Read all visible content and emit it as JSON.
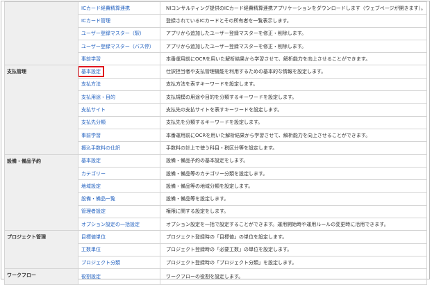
{
  "groups": [
    {
      "category": "",
      "rows": [
        {
          "link": "ICカード経費精算連携",
          "desc": "NIコンサルティング提供のICカード経費精算連携アプリケーションをダウンロードします（ウェブページが開きます）。"
        },
        {
          "link": "ICカード管理",
          "desc": "登録されているICカードとその所有者を一覧表示します。"
        },
        {
          "link": "ユーザー登録マスター（駅）",
          "desc": "アプリから追加したユーザー登録マスターを修正・削除します。"
        },
        {
          "link": "ユーザー登録マスター（バス停）",
          "desc": "アプリから追加したユーザー登録マスターを修正・削除します。"
        },
        {
          "link": "事前学習",
          "desc": "本番運用前にOCRを用いた解析結果から学習させて、解析能力を向上させることができます。"
        }
      ]
    },
    {
      "category": "支払管理",
      "rows": [
        {
          "link": "基本設定",
          "desc": "仕訳担当者や支払管理機能を利用するための基本的な情報を設定します。",
          "highlight": true
        },
        {
          "link": "支払方法",
          "desc": "支払方法を表すキーワードを設定します。"
        },
        {
          "link": "支払用途・目的",
          "desc": "支払規模の用途や目的を分類するキーワードを設定します。"
        },
        {
          "link": "支払サイト",
          "desc": "支払先の支払サイトを表すキーワードを設定します。"
        },
        {
          "link": "支払先分類",
          "desc": "支払先を分類するキーワードを設定します。"
        },
        {
          "link": "事前学習",
          "desc": "本番運用前にOCRを用いた解析結果から学習させて、解析能力を向上させることができます。"
        },
        {
          "link": "振込手数料の仕訳",
          "desc": "手数料の計上で使う科目・税区分等を設定します。"
        }
      ]
    },
    {
      "category": "設備・備品予約",
      "rows": [
        {
          "link": "基本設定",
          "desc": "設備・備品予約の基本設定をします。"
        },
        {
          "link": "カテゴリー",
          "desc": "設備・備品等のカテゴリー分類を設定します。"
        },
        {
          "link": "地域設定",
          "desc": "設備・備品等の地域分類を設定します。"
        },
        {
          "link": "設備・備品一覧",
          "desc": "設備・備品等を設定します。"
        },
        {
          "link": "管理者設定",
          "desc": "権限に関する設定をします。"
        },
        {
          "link": "オプション設定の一括設定",
          "desc": "オプション設定を一括で設定することができます。運用開始時や運用ルールの変更時に活用できます。"
        }
      ]
    },
    {
      "category": "プロジェクト管理",
      "rows": [
        {
          "link": "目標値単位",
          "desc": "プロジェクト登録時の「目標値」の単位を設定します。"
        },
        {
          "link": "工数単位",
          "desc": "プロジェクト登録時の「必要工数」の単位を設定します。"
        },
        {
          "link": "プロジェクト分類",
          "desc": "プロジェクト登録時の「プロジェクト分類」を設定します。"
        }
      ]
    },
    {
      "category": "ワークフロー",
      "rows": [
        {
          "link": "役割設定",
          "desc": "ワークフローの役割を設定します。"
        }
      ]
    }
  ],
  "colors": {
    "link": "#1f5fbf",
    "highlight_border": "#e0141e",
    "category_bg": "#efefef",
    "grid": "#d4d4d4"
  }
}
